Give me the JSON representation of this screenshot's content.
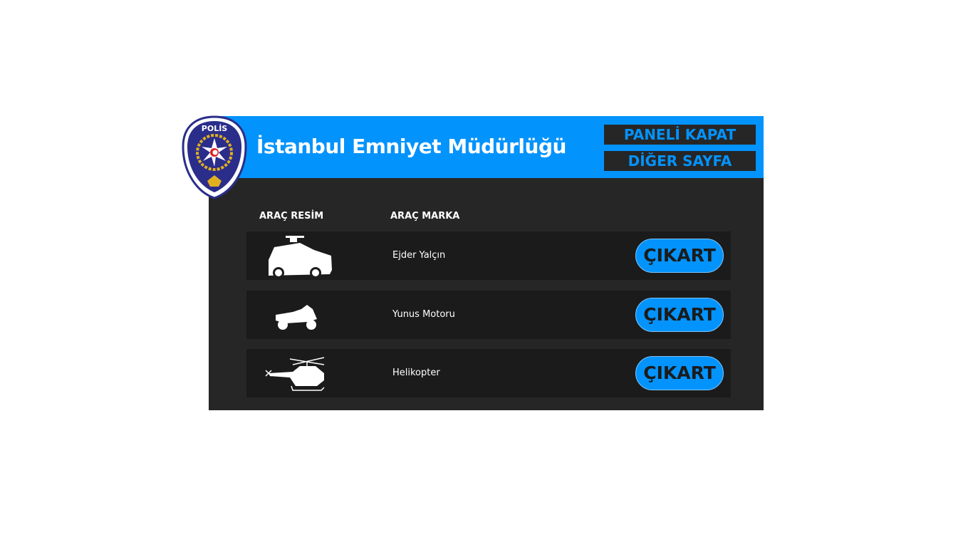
{
  "header": {
    "title": "İstanbul Emniyet Müdürlüğü",
    "close_panel": "PANELİ KAPAT",
    "other_page": "DİĞER SAYFA",
    "logo_text": "POLİS"
  },
  "columns": {
    "image": "ARAÇ RESİM",
    "brand": "ARAÇ MARKA"
  },
  "vehicles": [
    {
      "brand": "Ejder Yalçın",
      "icon": "armored-vehicle-icon",
      "action": "ÇIKART"
    },
    {
      "brand": "Yunus Motoru",
      "icon": "motorcycle-icon",
      "action": "ÇIKART"
    },
    {
      "brand": "Helikopter",
      "icon": "helicopter-icon",
      "action": "ÇIKART"
    }
  ],
  "colors": {
    "accent": "#0393fc",
    "panel": "#262626",
    "row": "#1b1b1b"
  }
}
